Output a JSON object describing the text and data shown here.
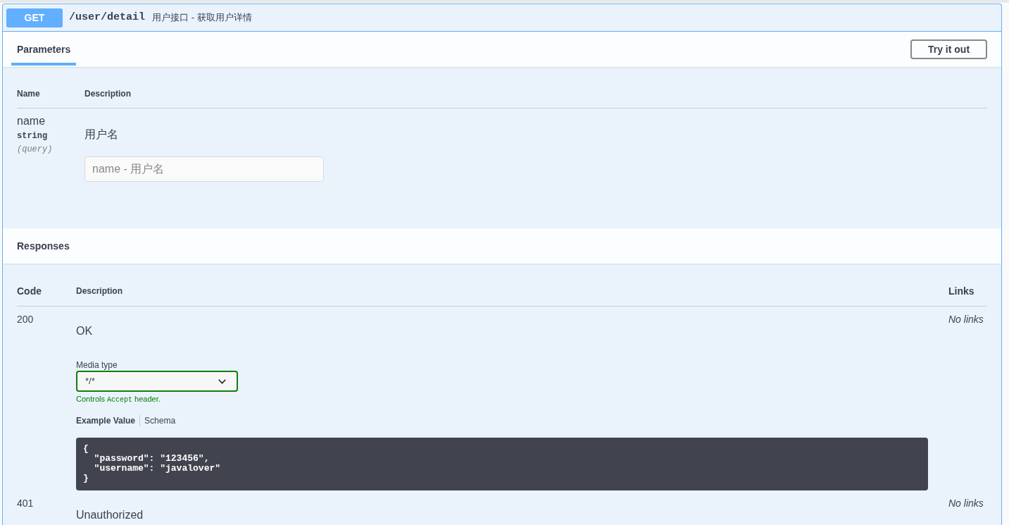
{
  "operation": {
    "method": "GET",
    "path": "/user/detail",
    "summary": "用户接口 - 获取用户详情"
  },
  "parameters_bar": {
    "tabs": [
      {
        "label": "Parameters",
        "selected": true
      }
    ],
    "try_it_out_button": "Try it out"
  },
  "parameters_table": {
    "columns": [
      "Name",
      "Description"
    ],
    "rows": [
      {
        "name": "name",
        "type": "string",
        "location": "(query)",
        "description": "用户名",
        "placeholder": "name - 用户名"
      }
    ]
  },
  "responses_bar": {
    "title": "Responses"
  },
  "responses_table": {
    "columns": [
      "Code",
      "Description",
      "Links"
    ],
    "rows": [
      {
        "code": "200",
        "description": "OK",
        "links": "No links",
        "media_type": {
          "label": "Media type",
          "value": "*/*",
          "hint": {
            "before": "Controls",
            "code": "Accept",
            "after": "header."
          }
        },
        "example_tabs": [
          {
            "label": "Example Value",
            "selected": true
          },
          {
            "label": "Schema",
            "selected": false
          }
        ],
        "example_value": "{\n  \"password\": \"123456\",\n  \"username\": \"javalover\"\n}"
      },
      {
        "code": "401",
        "description": "Unauthorized",
        "links": "No links"
      }
    ]
  }
}
